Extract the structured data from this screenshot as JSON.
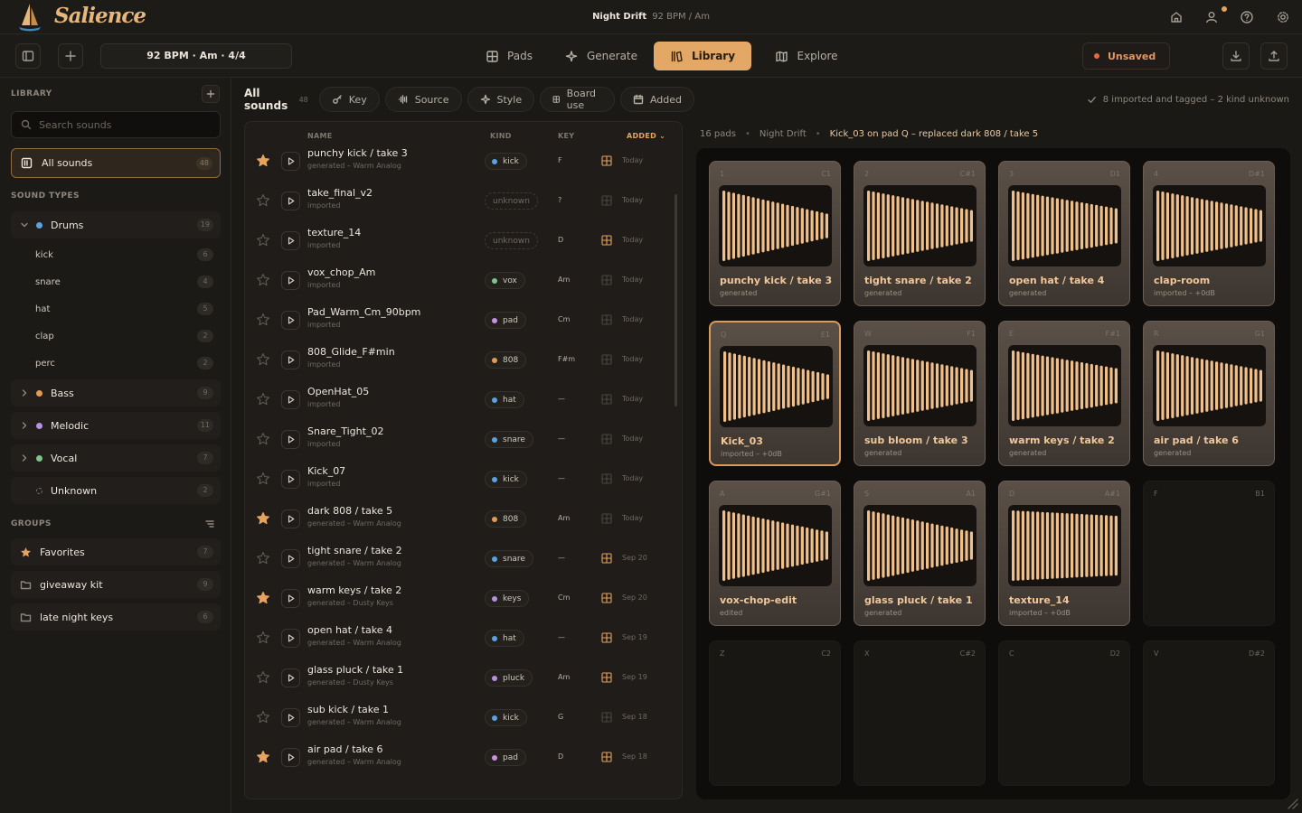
{
  "app": {
    "brand": "Salience",
    "project_name": "Night Drift",
    "project_meta": "92 BPM  /  Am"
  },
  "toolbar": {
    "tempo": "92 BPM · Am · 4/4",
    "tabs": [
      {
        "label": "Pads",
        "icon": "grid-icon"
      },
      {
        "label": "Generate",
        "icon": "sparkle-icon"
      },
      {
        "label": "Library",
        "icon": "library-icon",
        "active": true
      },
      {
        "label": "Explore",
        "icon": "map-icon"
      }
    ],
    "unsaved": "Unsaved"
  },
  "sidebar": {
    "library_title": "LIBRARY",
    "search_placeholder": "Search sounds",
    "all_sounds": {
      "label": "All sounds",
      "count": "48"
    },
    "sound_types_title": "SOUND TYPES",
    "drums": {
      "label": "Drums",
      "count": "19",
      "color": "#5aa3e0"
    },
    "drum_subs": [
      {
        "label": "kick",
        "count": "6"
      },
      {
        "label": "snare",
        "count": "4"
      },
      {
        "label": "hat",
        "count": "5"
      },
      {
        "label": "clap",
        "count": "2"
      },
      {
        "label": "perc",
        "count": "2"
      }
    ],
    "cats": [
      {
        "label": "Bass",
        "count": "9",
        "color": "#e49a55"
      },
      {
        "label": "Melodic",
        "count": "11",
        "color": "#b592e0"
      },
      {
        "label": "Vocal",
        "count": "7",
        "color": "#7fc58c"
      }
    ],
    "unknown": {
      "label": "Unknown",
      "count": "2"
    },
    "groups_title": "GROUPS",
    "groups": [
      {
        "label": "Favorites",
        "count": "7",
        "icon": "star-icon"
      },
      {
        "label": "giveaway kit",
        "count": "9",
        "icon": "folder-icon"
      },
      {
        "label": "late night keys",
        "count": "6",
        "icon": "folder-icon"
      }
    ]
  },
  "list": {
    "title": "All sounds",
    "count": "48",
    "filters": [
      "Key",
      "Source",
      "Style",
      "Board use",
      "Added"
    ],
    "columns": {
      "name": "NAME",
      "kind": "KIND",
      "key": "KEY",
      "added": "ADDED"
    },
    "rows": [
      {
        "name": "punchy kick / take 3",
        "source": "generated – Warm Analog",
        "kind": "kick",
        "kind_color": "#5aa3e0",
        "key": "F",
        "added": "Today",
        "fav": true,
        "on_board": true
      },
      {
        "name": "take_final_v2",
        "source": "imported",
        "kind": "unknown",
        "kind_color": "",
        "key": "?",
        "added": "Today",
        "fav": false,
        "on_board": false
      },
      {
        "name": "texture_14",
        "source": "imported",
        "kind": "unknown",
        "kind_color": "",
        "key": "D",
        "added": "Today",
        "fav": false,
        "on_board": true
      },
      {
        "name": "vox_chop_Am",
        "source": "imported",
        "kind": "vox",
        "kind_color": "#7fc58c",
        "key": "Am",
        "added": "Today",
        "fav": false,
        "on_board": false
      },
      {
        "name": "Pad_Warm_Cm_90bpm",
        "source": "imported",
        "kind": "pad",
        "kind_color": "#c792e0",
        "key": "Cm",
        "added": "Today",
        "fav": false,
        "on_board": false
      },
      {
        "name": "808_Glide_F#min",
        "source": "imported",
        "kind": "808",
        "kind_color": "#e49a55",
        "key": "F#m",
        "added": "Today",
        "fav": false,
        "on_board": false
      },
      {
        "name": "OpenHat_05",
        "source": "imported",
        "kind": "hat",
        "kind_color": "#5aa3e0",
        "key": "—",
        "added": "Today",
        "fav": false,
        "on_board": false
      },
      {
        "name": "Snare_Tight_02",
        "source": "imported",
        "kind": "snare",
        "kind_color": "#5aa3e0",
        "key": "—",
        "added": "Today",
        "fav": false,
        "on_board": false
      },
      {
        "name": "Kick_07",
        "source": "imported",
        "kind": "kick",
        "kind_color": "#5aa3e0",
        "key": "—",
        "added": "Today",
        "fav": false,
        "on_board": false
      },
      {
        "name": "dark 808 / take 5",
        "source": "generated – Warm Analog",
        "kind": "808",
        "kind_color": "#e49a55",
        "key": "Am",
        "added": "Today",
        "fav": true,
        "on_board": false
      },
      {
        "name": "tight snare / take 2",
        "source": "generated – Warm Analog",
        "kind": "snare",
        "kind_color": "#5aa3e0",
        "key": "—",
        "added": "Sep 20",
        "fav": false,
        "on_board": true
      },
      {
        "name": "warm keys / take 2",
        "source": "generated – Dusty Keys",
        "kind": "keys",
        "kind_color": "#b592e0",
        "key": "Cm",
        "added": "Sep 20",
        "fav": true,
        "on_board": true
      },
      {
        "name": "open hat / take 4",
        "source": "generated – Warm Analog",
        "kind": "hat",
        "kind_color": "#5aa3e0",
        "key": "—",
        "added": "Sep 19",
        "fav": false,
        "on_board": true
      },
      {
        "name": "glass pluck / take 1",
        "source": "generated – Dusty Keys",
        "kind": "pluck",
        "kind_color": "#b592e0",
        "key": "Am",
        "added": "Sep 19",
        "fav": false,
        "on_board": true
      },
      {
        "name": "sub kick / take 1",
        "source": "generated – Warm Analog",
        "kind": "kick",
        "kind_color": "#5aa3e0",
        "key": "G",
        "added": "Sep 18",
        "fav": false,
        "on_board": false
      },
      {
        "name": "air pad / take 6",
        "source": "generated – Warm Analog",
        "kind": "pad",
        "kind_color": "#c792e0",
        "key": "D",
        "added": "Sep 18",
        "fav": true,
        "on_board": true
      }
    ]
  },
  "board": {
    "status": "8 imported and tagged – 2 kind unknown",
    "pads_count": "16 pads",
    "project": "Night Drift",
    "last_action": "Kick_03 on pad Q – replaced dark 808 / take 5",
    "pads": [
      {
        "key": "1",
        "note": "C1",
        "title": "punchy kick / take 3",
        "sub": "generated",
        "filled": true,
        "decay": 0.35
      },
      {
        "key": "2",
        "note": "C#1",
        "title": "tight snare / take 2",
        "sub": "generated",
        "filled": true,
        "decay": 0.45
      },
      {
        "key": "3",
        "note": "D1",
        "title": "open hat / take 4",
        "sub": "generated",
        "filled": true,
        "decay": 0.5
      },
      {
        "key": "4",
        "note": "D#1",
        "title": "clap-room",
        "sub": "imported – +0dB",
        "filled": true,
        "decay": 0.45
      },
      {
        "key": "Q",
        "note": "E1",
        "title": "Kick_03",
        "sub": "imported – +0dB",
        "filled": true,
        "selected": true,
        "decay": 0.35
      },
      {
        "key": "W",
        "note": "F1",
        "title": "sub bloom / take 3",
        "sub": "generated",
        "filled": true,
        "decay": 0.45
      },
      {
        "key": "E",
        "note": "F#1",
        "title": "warm keys / take 2",
        "sub": "generated",
        "filled": true,
        "decay": 0.5
      },
      {
        "key": "R",
        "note": "G1",
        "title": "air pad / take 6",
        "sub": "generated",
        "filled": true,
        "decay": 0.45
      },
      {
        "key": "A",
        "note": "G#1",
        "title": "vox-chop-edit",
        "sub": "edited",
        "filled": true,
        "decay": 0.4
      },
      {
        "key": "S",
        "note": "A1",
        "title": "glass pluck / take 1",
        "sub": "generated",
        "filled": true,
        "decay": 0.4
      },
      {
        "key": "D",
        "note": "A#1",
        "title": "texture_14",
        "sub": "imported – +0dB",
        "filled": true,
        "decay": 0.85
      },
      {
        "key": "F",
        "note": "B1",
        "title": "",
        "sub": "",
        "filled": false
      },
      {
        "key": "Z",
        "note": "C2",
        "title": "",
        "sub": "",
        "filled": false
      },
      {
        "key": "X",
        "note": "C#2",
        "title": "",
        "sub": "",
        "filled": false
      },
      {
        "key": "C",
        "note": "D2",
        "title": "",
        "sub": "",
        "filled": false
      },
      {
        "key": "V",
        "note": "D#2",
        "title": "",
        "sub": "",
        "filled": false
      }
    ]
  },
  "colors": {
    "accent": "#e3a766",
    "unsaved": "#e36a45",
    "waveform": "#f1c08a"
  }
}
